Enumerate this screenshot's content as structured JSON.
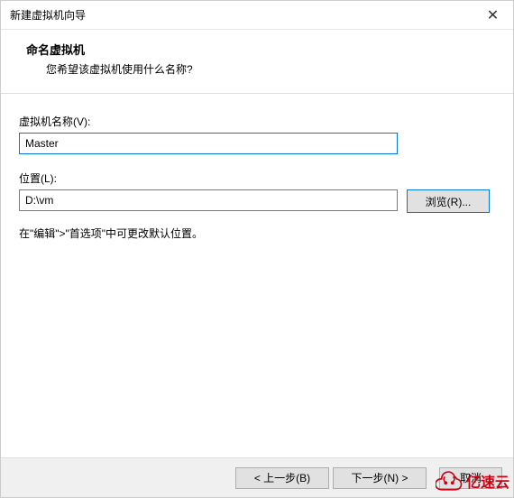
{
  "titlebar": {
    "title": "新建虚拟机向导"
  },
  "header": {
    "title": "命名虚拟机",
    "description": "您希望该虚拟机使用什么名称?"
  },
  "fields": {
    "name_label": "虚拟机名称(V):",
    "name_value": "Master",
    "location_label": "位置(L):",
    "location_value": "D:\\vm",
    "browse_label": "浏览(R)..."
  },
  "note": "在\"编辑\">\"首选项\"中可更改默认位置。",
  "footer": {
    "back": "< 上一步(B)",
    "next": "下一步(N) >",
    "cancel": "取消"
  },
  "watermark": {
    "text": "亿速云"
  }
}
